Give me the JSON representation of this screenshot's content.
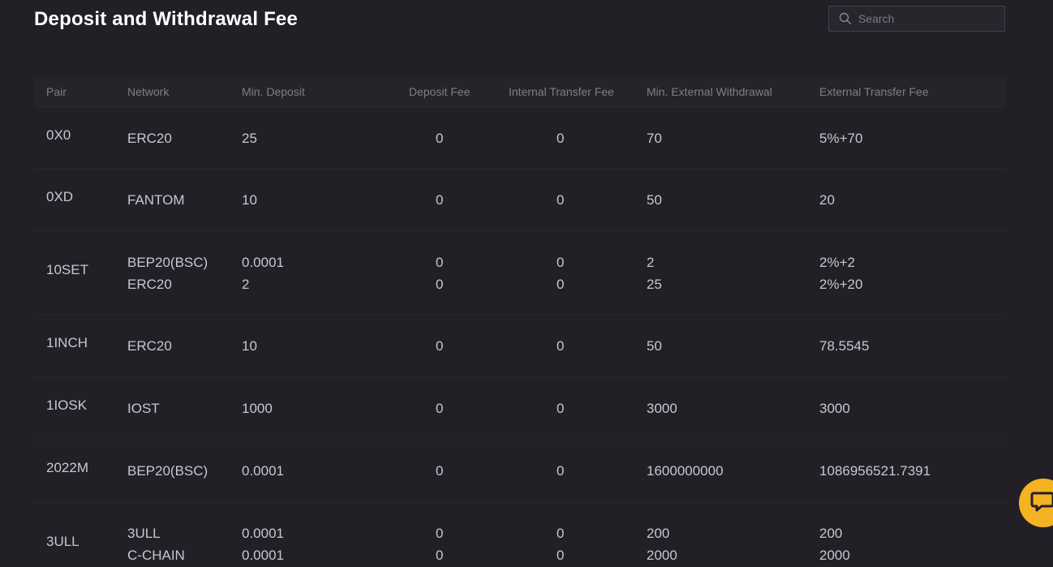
{
  "header": {
    "title": "Deposit and Withdrawal Fee"
  },
  "search": {
    "placeholder": "Search",
    "icon": "search-icon"
  },
  "table": {
    "columns": [
      "Pair",
      "Network",
      "Min. Deposit",
      "Deposit Fee",
      "Internal Transfer Fee",
      "Min. External Withdrawal",
      "External Transfer Fee"
    ],
    "rows": [
      {
        "pair": "0X0",
        "entries": [
          {
            "network": "ERC20",
            "min_deposit": "25",
            "deposit_fee": "0",
            "internal_fee": "0",
            "min_withdrawal": "70",
            "external_fee": "5%+70"
          }
        ]
      },
      {
        "pair": "0XD",
        "entries": [
          {
            "network": "FANTOM",
            "min_deposit": "10",
            "deposit_fee": "0",
            "internal_fee": "0",
            "min_withdrawal": "50",
            "external_fee": "20"
          }
        ]
      },
      {
        "pair": "10SET",
        "entries": [
          {
            "network": "BEP20(BSC)",
            "min_deposit": "0.0001",
            "deposit_fee": "0",
            "internal_fee": "0",
            "min_withdrawal": "2",
            "external_fee": "2%+2"
          },
          {
            "network": "ERC20",
            "min_deposit": "2",
            "deposit_fee": "0",
            "internal_fee": "0",
            "min_withdrawal": "25",
            "external_fee": "2%+20"
          }
        ]
      },
      {
        "pair": "1INCH",
        "entries": [
          {
            "network": "ERC20",
            "min_deposit": "10",
            "deposit_fee": "0",
            "internal_fee": "0",
            "min_withdrawal": "50",
            "external_fee": "78.5545"
          }
        ]
      },
      {
        "pair": "1IOSK",
        "entries": [
          {
            "network": "IOST",
            "min_deposit": "1000",
            "deposit_fee": "0",
            "internal_fee": "0",
            "min_withdrawal": "3000",
            "external_fee": "3000"
          }
        ]
      },
      {
        "pair": "2022M",
        "entries": [
          {
            "network": "BEP20(BSC)",
            "min_deposit": "0.0001",
            "deposit_fee": "0",
            "internal_fee": "0",
            "min_withdrawal": "1600000000",
            "external_fee": "1086956521.7391"
          }
        ]
      },
      {
        "pair": "3ULL",
        "entries": [
          {
            "network": "3ULL",
            "min_deposit": "0.0001",
            "deposit_fee": "0",
            "internal_fee": "0",
            "min_withdrawal": "200",
            "external_fee": "200"
          },
          {
            "network": "C-CHAIN",
            "min_deposit": "0.0001",
            "deposit_fee": "0",
            "internal_fee": "0",
            "min_withdrawal": "2000",
            "external_fee": "2000"
          }
        ]
      }
    ]
  },
  "chat_widget": {
    "icon": "chat-bubble-icon"
  },
  "colors": {
    "background": "#221f27",
    "header_bg": "#262329",
    "accent": "#f5b323",
    "text": "#c9c6cf",
    "muted": "#817d88"
  }
}
